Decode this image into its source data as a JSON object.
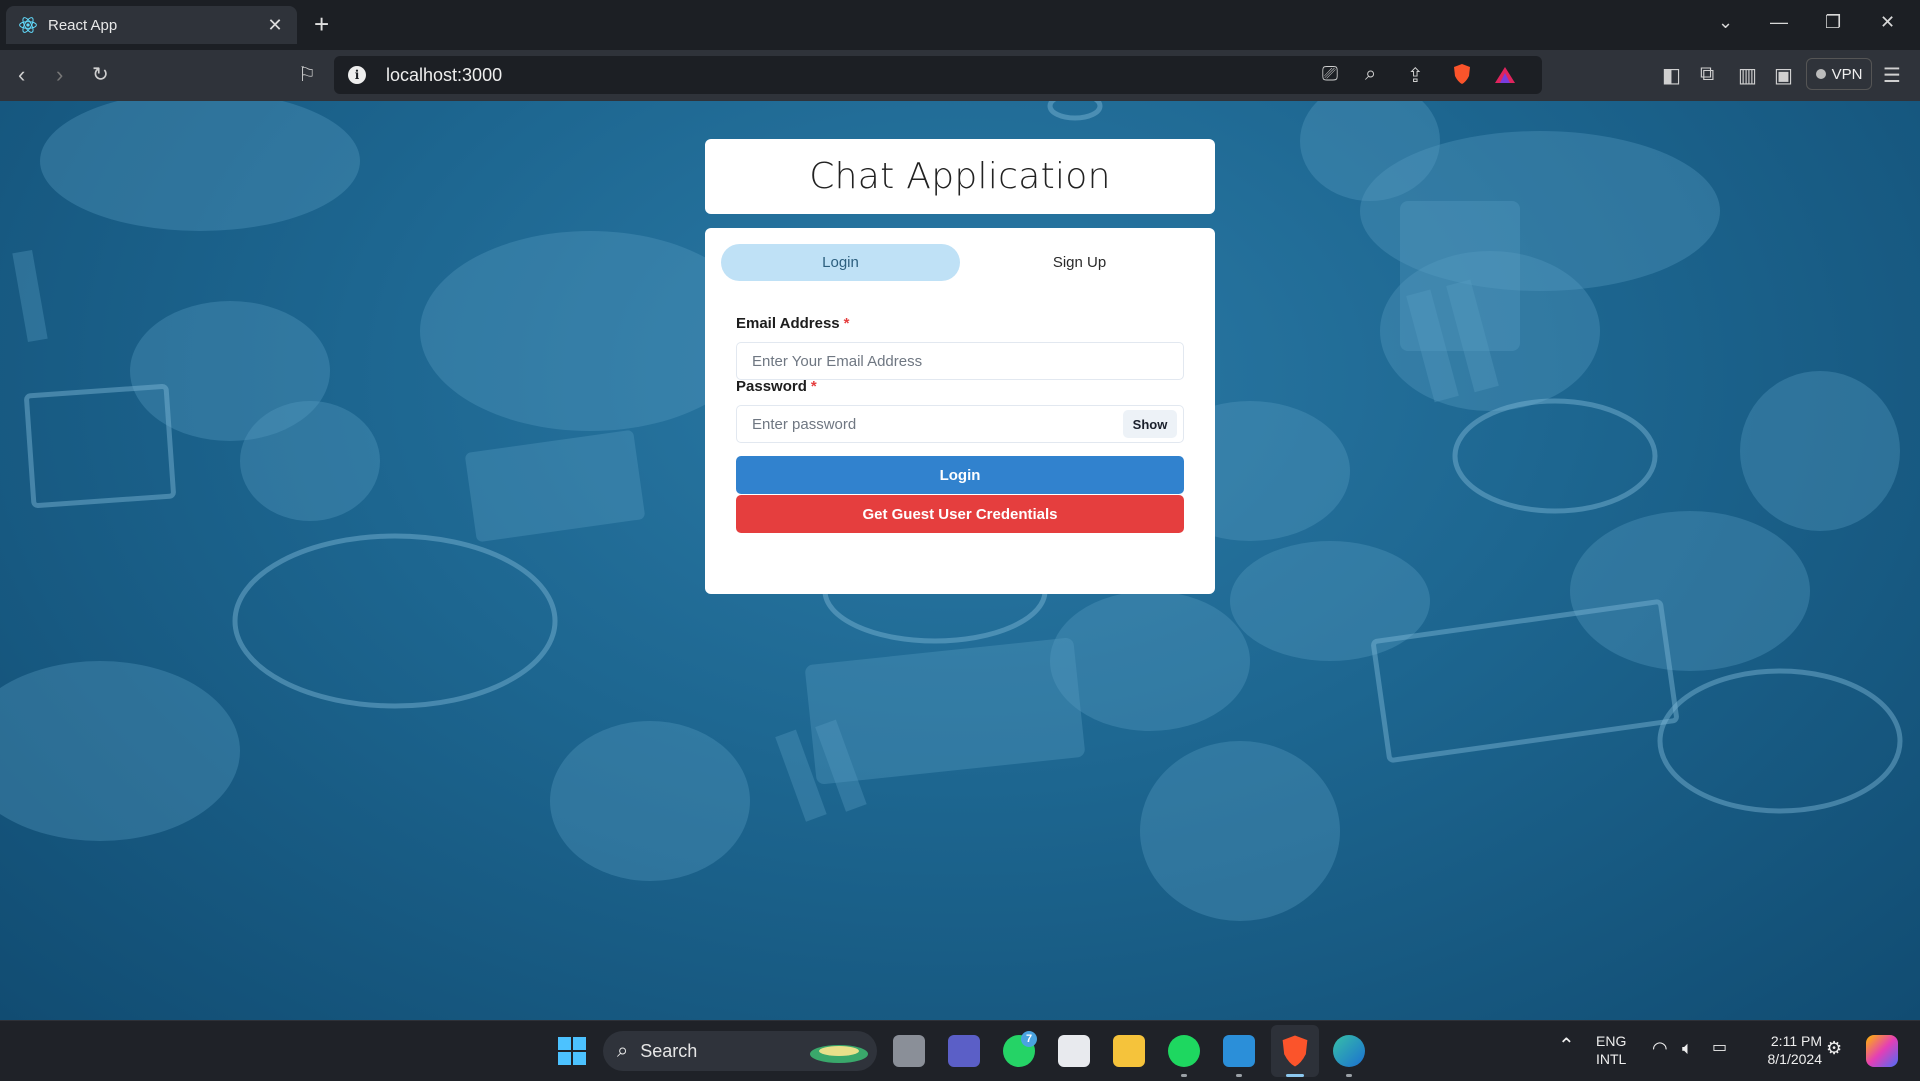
{
  "browser": {
    "tab_title": "React App",
    "url": "localhost:3000",
    "vpn_label": "VPN"
  },
  "page": {
    "header_title": "Chat Application",
    "tabs": [
      {
        "label": "Login",
        "active": true
      },
      {
        "label": "Sign Up",
        "active": false
      }
    ],
    "email": {
      "label": "Email Address",
      "required_mark": "*",
      "placeholder": "Enter Your Email Address",
      "value": ""
    },
    "password": {
      "label": "Password",
      "required_mark": "*",
      "placeholder": "Enter password",
      "value": "",
      "toggle_label": "Show"
    },
    "login_button": "Login",
    "guest_button": "Get Guest User Credentials"
  },
  "taskbar": {
    "search_label": "Search",
    "whatsapp_badge": "7",
    "lang_line1": "ENG",
    "lang_line2": "INTL",
    "time": "2:11 PM",
    "date": "8/1/2024"
  },
  "colors": {
    "login_button": "#3182ce",
    "guest_button": "#e53e3e",
    "active_tab": "#bfe1f6",
    "background": "#1d6690"
  }
}
